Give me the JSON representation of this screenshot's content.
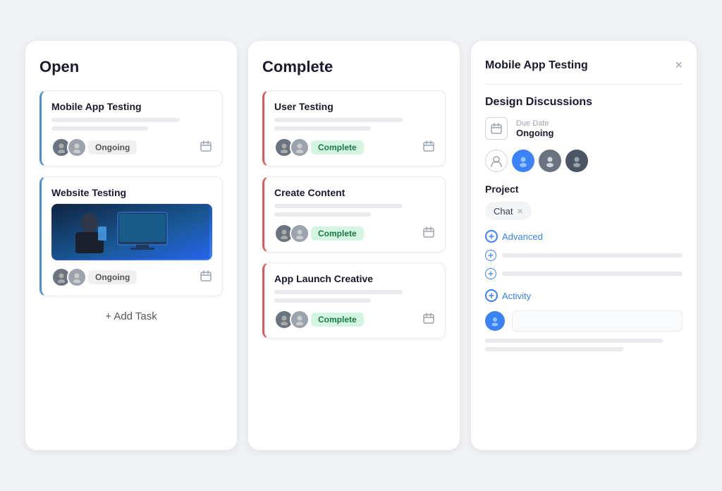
{
  "board": {
    "columns": {
      "open": {
        "title": "Open",
        "tasks": [
          {
            "id": "mobile-app-testing",
            "title": "Mobile App Testing",
            "status": "Ongoing",
            "has_image": false
          },
          {
            "id": "website-testing",
            "title": "Website Testing",
            "status": "Ongoing",
            "has_image": true
          }
        ],
        "add_task_label": "+ Add Task"
      },
      "complete": {
        "title": "Complete",
        "tasks": [
          {
            "id": "user-testing",
            "title": "User Testing",
            "status": "Complete"
          },
          {
            "id": "create-content",
            "title": "Create Content",
            "status": "Complete"
          },
          {
            "id": "app-launch-creative",
            "title": "App Launch Creative",
            "status": "Complete"
          }
        ]
      }
    },
    "detail": {
      "header_task": "Mobile App Testing",
      "section_title": "Design Discussions",
      "due_date_label": "Due Date",
      "due_date_value": "Ongoing",
      "project_label": "Project",
      "project_tag": "Chat",
      "advanced_label": "Advanced",
      "activity_label": "Activity"
    }
  },
  "icons": {
    "close": "×",
    "calendar": "📅",
    "chevron_down": "⌄",
    "circle_arrow": "⊙"
  }
}
